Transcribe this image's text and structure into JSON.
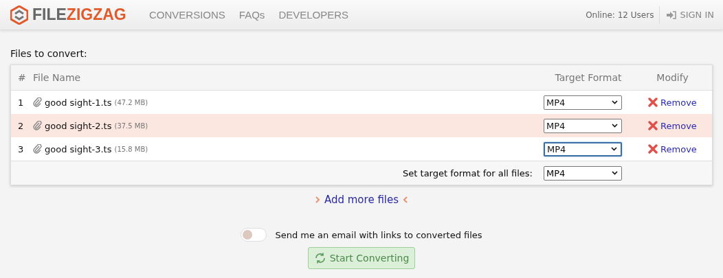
{
  "header": {
    "logo": {
      "prefix": "FILE",
      "suffix": "ZIGZAG"
    },
    "nav": [
      {
        "label": "CONVERSIONS"
      },
      {
        "label": "FAQs"
      },
      {
        "label": "DEVELOPERS"
      }
    ],
    "online": "Online: 12 Users",
    "sign_in": "SIGN IN"
  },
  "title": "Files to convert:",
  "table": {
    "columns": [
      "#",
      "File Name",
      "Target Format",
      "Modify"
    ],
    "rows": [
      {
        "index": "1",
        "name": "good sight-1.ts",
        "size": "(47.2 MB)",
        "format": "MP4",
        "focused": false,
        "highlighted": false,
        "action": "Remove"
      },
      {
        "index": "2",
        "name": "good sight-2.ts",
        "size": "(37.5 MB)",
        "format": "MP4",
        "focused": false,
        "highlighted": true,
        "action": "Remove"
      },
      {
        "index": "3",
        "name": "good sight-3.ts",
        "size": "(15.8 MB)",
        "format": "MP4",
        "focused": true,
        "highlighted": false,
        "action": "Remove"
      }
    ],
    "footer": {
      "label": "Set target format for all files:",
      "format": "MP4"
    }
  },
  "add_more": "Add more files",
  "email_toggle": {
    "label": "Send me an email with links to converted files",
    "on": false
  },
  "start_button": "Start Converting"
}
